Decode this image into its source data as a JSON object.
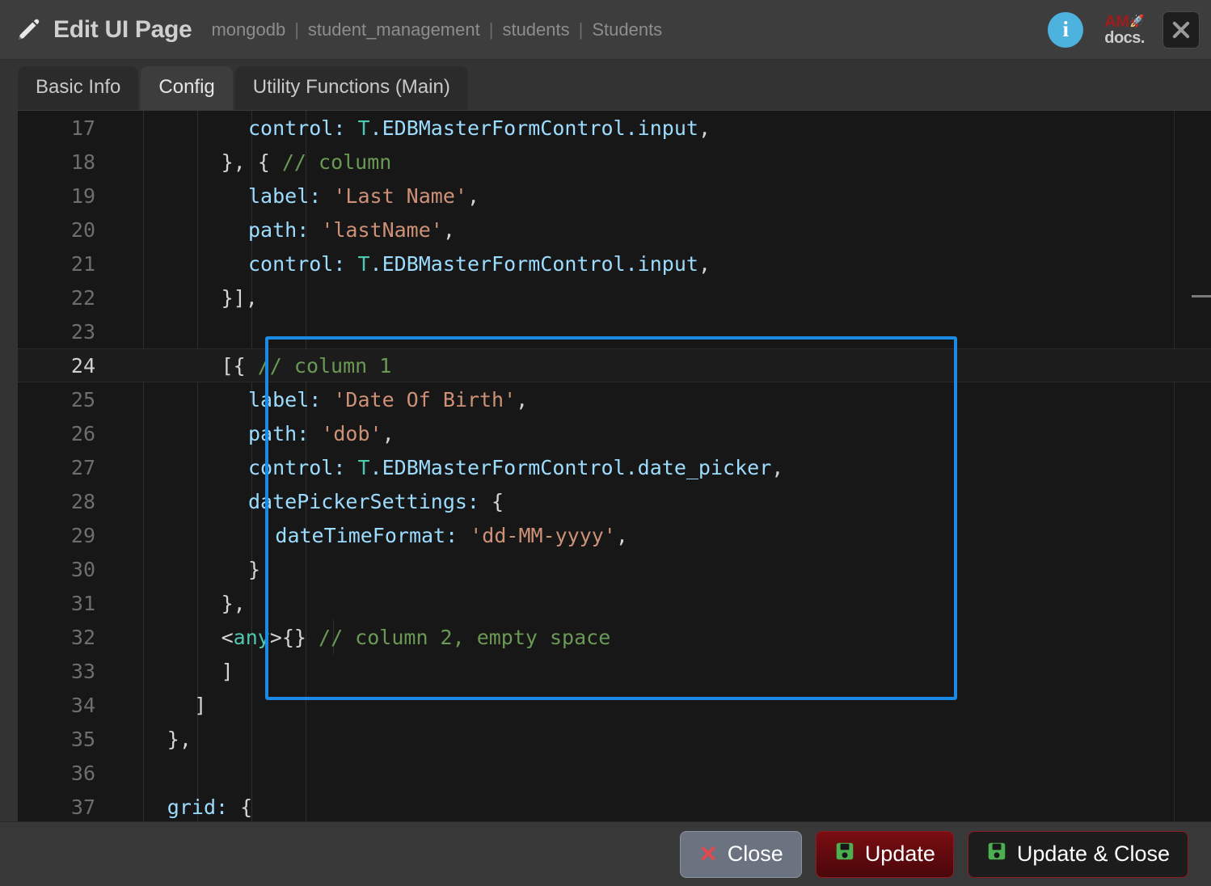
{
  "header": {
    "icon": "pencil-icon",
    "title": "Edit UI Page",
    "breadcrumb": [
      "mongodb",
      "student_management",
      "students",
      "Students"
    ],
    "separator": "|",
    "info_icon_label": "i",
    "logo_top": "AM",
    "logo_rocket": "🚀",
    "logo_bottom": "docs.",
    "close_label": "×"
  },
  "tabs": [
    {
      "label": "Basic Info",
      "active": false
    },
    {
      "label": "Config",
      "active": true
    },
    {
      "label": "Utility Functions (Main)",
      "active": false
    }
  ],
  "editor": {
    "language": "javascript",
    "first_visible_line": 17,
    "active_line": 24,
    "highlight_color": "#1a8ae5",
    "lines": [
      {
        "no": "17",
        "indent": 5,
        "tokens": [
          {
            "t": "control:",
            "c": "k-prop"
          },
          {
            "t": " ",
            "c": "k-plain"
          },
          {
            "t": "T",
            "c": "k-type"
          },
          {
            "t": ".EDBMasterFormControl.input",
            "c": "k-prop"
          },
          {
            "t": ",",
            "c": "k-plain"
          }
        ]
      },
      {
        "no": "18",
        "indent": 4,
        "tokens": [
          {
            "t": "}, { ",
            "c": "k-plain"
          },
          {
            "t": "// column",
            "c": "k-com"
          }
        ]
      },
      {
        "no": "19",
        "indent": 5,
        "tokens": [
          {
            "t": "label:",
            "c": "k-prop"
          },
          {
            "t": " ",
            "c": "k-plain"
          },
          {
            "t": "'Last Name'",
            "c": "k-str"
          },
          {
            "t": ",",
            "c": "k-plain"
          }
        ]
      },
      {
        "no": "20",
        "indent": 5,
        "tokens": [
          {
            "t": "path:",
            "c": "k-prop"
          },
          {
            "t": " ",
            "c": "k-plain"
          },
          {
            "t": "'lastName'",
            "c": "k-str"
          },
          {
            "t": ",",
            "c": "k-plain"
          }
        ]
      },
      {
        "no": "21",
        "indent": 5,
        "tokens": [
          {
            "t": "control:",
            "c": "k-prop"
          },
          {
            "t": " ",
            "c": "k-plain"
          },
          {
            "t": "T",
            "c": "k-type"
          },
          {
            "t": ".EDBMasterFormControl.input",
            "c": "k-prop"
          },
          {
            "t": ",",
            "c": "k-plain"
          }
        ]
      },
      {
        "no": "22",
        "indent": 4,
        "tokens": [
          {
            "t": "}],",
            "c": "k-plain"
          }
        ]
      },
      {
        "no": "23",
        "indent": 0,
        "tokens": []
      },
      {
        "no": "24",
        "indent": 4,
        "tokens": [
          {
            "t": "[{ ",
            "c": "k-plain"
          },
          {
            "t": "// column 1",
            "c": "k-com"
          }
        ]
      },
      {
        "no": "25",
        "indent": 5,
        "tokens": [
          {
            "t": "label:",
            "c": "k-prop"
          },
          {
            "t": " ",
            "c": "k-plain"
          },
          {
            "t": "'Date Of Birth'",
            "c": "k-str"
          },
          {
            "t": ",",
            "c": "k-plain"
          }
        ]
      },
      {
        "no": "26",
        "indent": 5,
        "tokens": [
          {
            "t": "path:",
            "c": "k-prop"
          },
          {
            "t": " ",
            "c": "k-plain"
          },
          {
            "t": "'dob'",
            "c": "k-str"
          },
          {
            "t": ",",
            "c": "k-plain"
          }
        ]
      },
      {
        "no": "27",
        "indent": 5,
        "tokens": [
          {
            "t": "control:",
            "c": "k-prop"
          },
          {
            "t": " ",
            "c": "k-plain"
          },
          {
            "t": "T",
            "c": "k-type"
          },
          {
            "t": ".EDBMasterFormControl.date_picker",
            "c": "k-prop"
          },
          {
            "t": ",",
            "c": "k-plain"
          }
        ]
      },
      {
        "no": "28",
        "indent": 5,
        "tokens": [
          {
            "t": "datePickerSettings:",
            "c": "k-prop"
          },
          {
            "t": " {",
            "c": "k-plain"
          }
        ]
      },
      {
        "no": "29",
        "indent": 6,
        "tokens": [
          {
            "t": "dateTimeFormat:",
            "c": "k-prop"
          },
          {
            "t": " ",
            "c": "k-plain"
          },
          {
            "t": "'dd-MM-yyyy'",
            "c": "k-str"
          },
          {
            "t": ",",
            "c": "k-plain"
          }
        ]
      },
      {
        "no": "30",
        "indent": 5,
        "tokens": [
          {
            "t": "}",
            "c": "k-plain"
          }
        ]
      },
      {
        "no": "31",
        "indent": 4,
        "tokens": [
          {
            "t": "},",
            "c": "k-plain"
          }
        ]
      },
      {
        "no": "32",
        "indent": 4,
        "tokens": [
          {
            "t": "<",
            "c": "k-plain"
          },
          {
            "t": "any",
            "c": "k-type"
          },
          {
            "t": ">{} ",
            "c": "k-plain"
          },
          {
            "t": "// column 2, empty space",
            "c": "k-com"
          }
        ]
      },
      {
        "no": "33",
        "indent": 4,
        "tokens": [
          {
            "t": "]",
            "c": "k-plain"
          }
        ]
      },
      {
        "no": "34",
        "indent": 3,
        "tokens": [
          {
            "t": "]",
            "c": "k-plain"
          }
        ]
      },
      {
        "no": "35",
        "indent": 2,
        "tokens": [
          {
            "t": "},",
            "c": "k-plain"
          }
        ]
      },
      {
        "no": "36",
        "indent": 0,
        "tokens": []
      },
      {
        "no": "37",
        "indent": 2,
        "tokens": [
          {
            "t": "grid:",
            "c": "k-prop"
          },
          {
            "t": " {",
            "c": "k-plain"
          }
        ]
      }
    ],
    "indent_guide_positions": [
      155,
      222,
      289,
      356
    ],
    "highlight_block": {
      "line_start": "24",
      "line_end": "33"
    }
  },
  "footer": {
    "buttons": [
      {
        "label": "Close",
        "icon": "close-x-icon",
        "style": "close"
      },
      {
        "label": "Update",
        "icon": "save-icon",
        "style": "update"
      },
      {
        "label": "Update & Close",
        "icon": "save-icon",
        "style": "update-close"
      }
    ]
  }
}
